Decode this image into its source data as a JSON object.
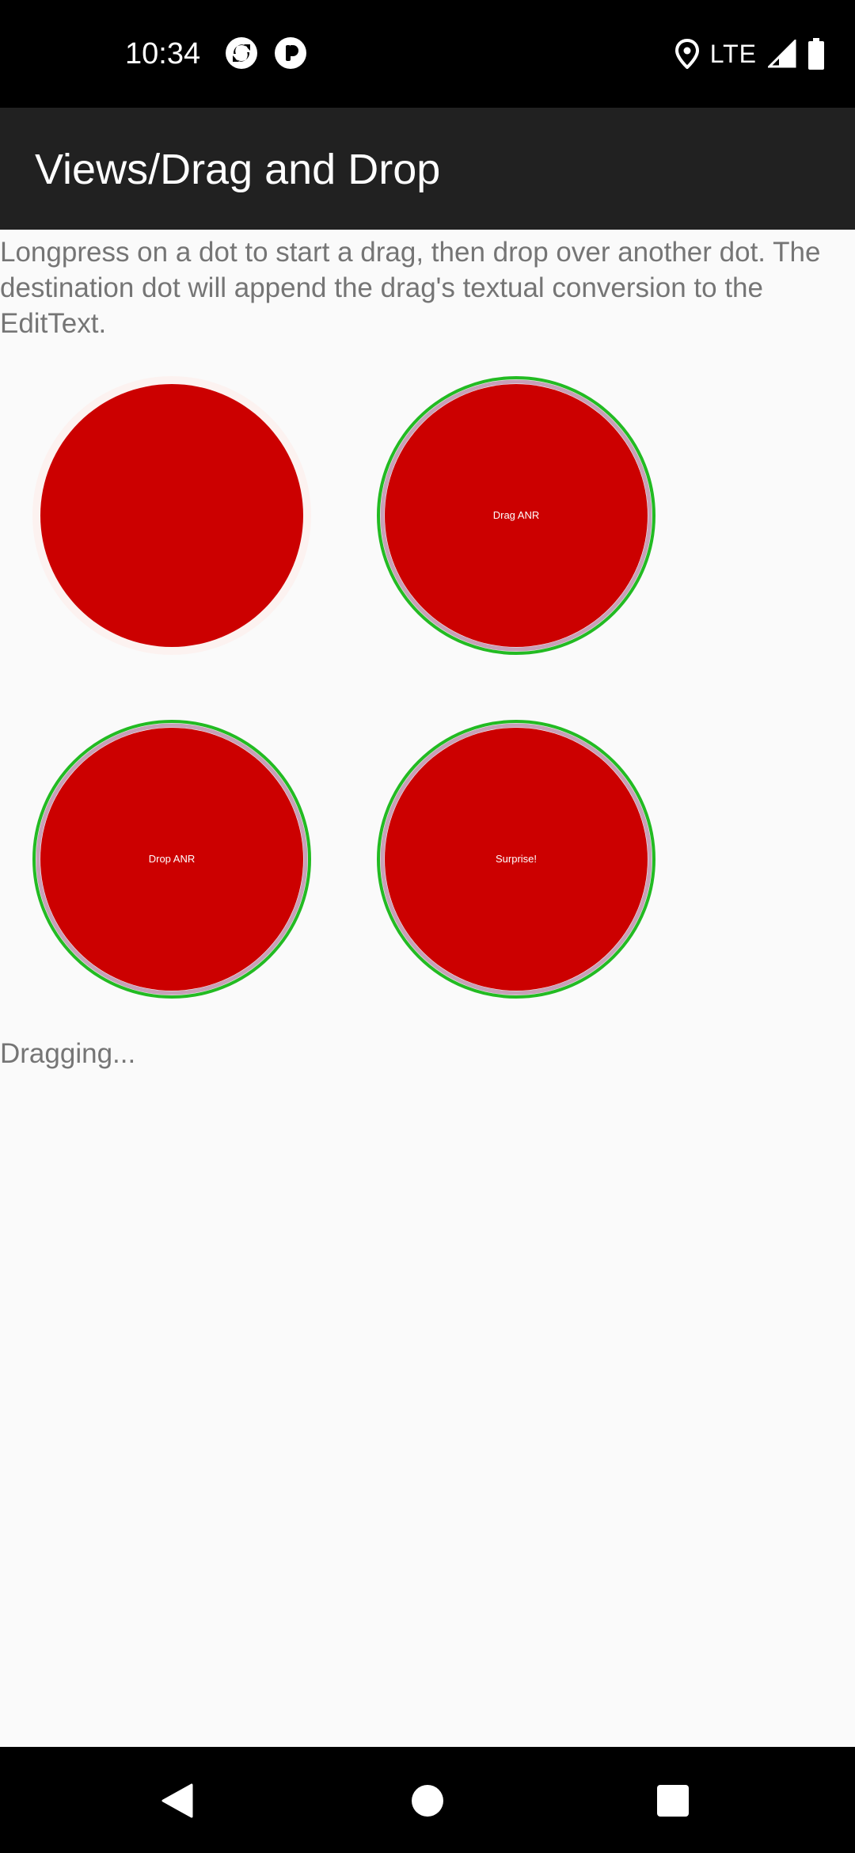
{
  "status_bar": {
    "time": "10:34",
    "network": "LTE",
    "icons": [
      "sync-icon",
      "app-notification-icon",
      "location-icon",
      "signal-icon",
      "battery-icon"
    ]
  },
  "app_bar": {
    "title": "Views/Drag and Drop"
  },
  "main": {
    "description": "Longpress on a dot to start a drag, then drop over another dot. The destination dot will append the drag's textual conversion to the EditText.",
    "dots": [
      {
        "label": "",
        "state": "dragging"
      },
      {
        "label": "Drag ANR",
        "state": "drop-target"
      },
      {
        "label": "Drop ANR",
        "state": "drop-target"
      },
      {
        "label": "Surprise!",
        "state": "drop-target"
      }
    ],
    "status_text": "Dragging..."
  },
  "nav_bar": {
    "buttons": [
      "back",
      "home",
      "recents"
    ]
  },
  "colors": {
    "dot_fill": "#cc0000",
    "target_ring": "#22bb22",
    "inner_ring": "#c8a0b8",
    "app_bar": "#212121",
    "background": "#fafafa"
  }
}
